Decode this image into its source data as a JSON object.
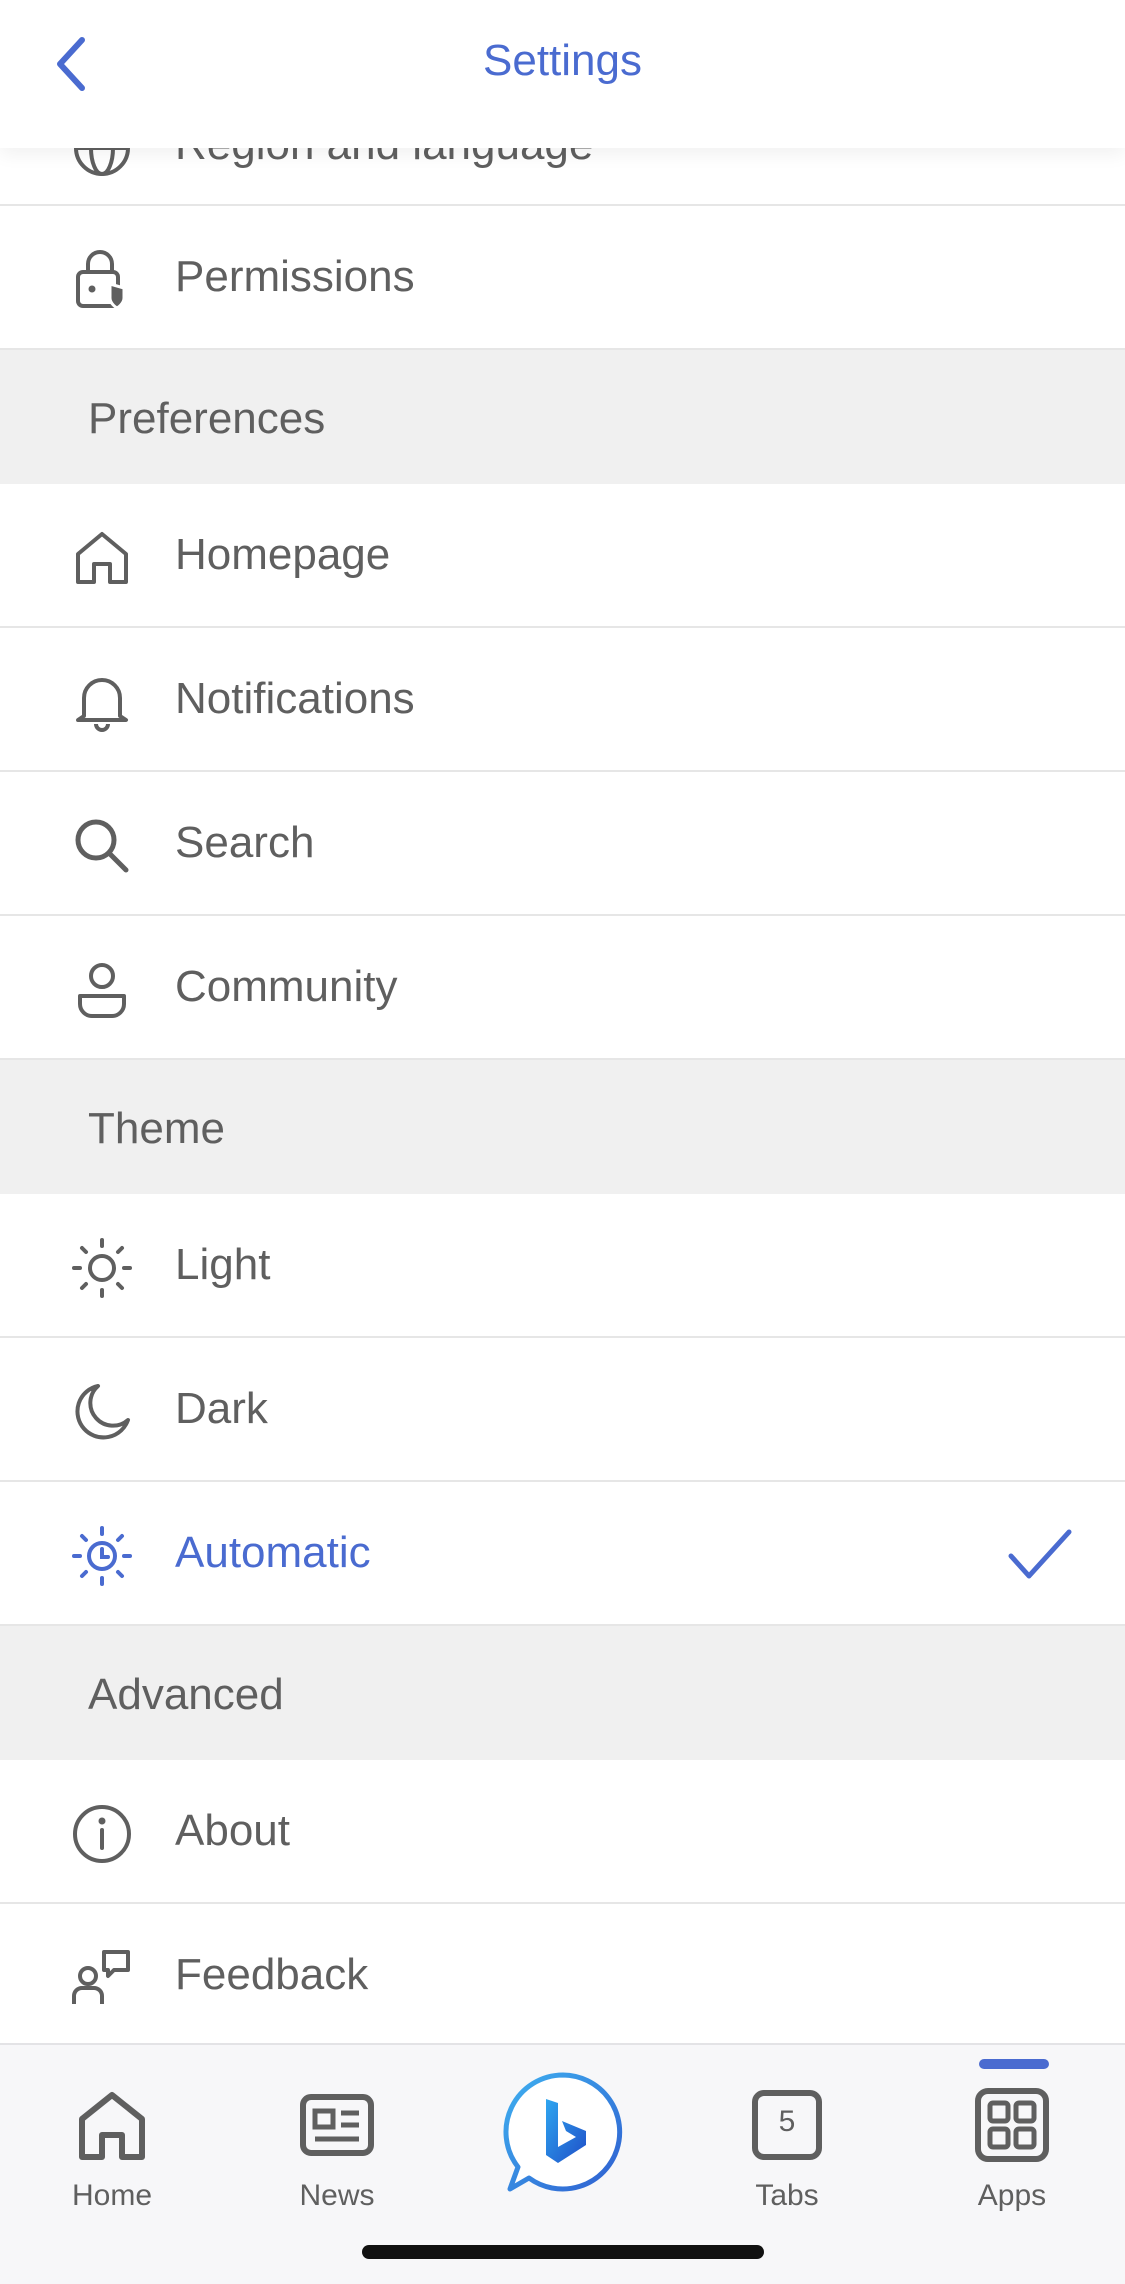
{
  "header": {
    "title": "Settings"
  },
  "partial_row": {
    "label": "Region and language"
  },
  "rows_top": [
    {
      "label": "Permissions",
      "icon": "lock-shield-icon"
    }
  ],
  "sections": {
    "preferences": "Preferences",
    "theme": "Theme",
    "advanced": "Advanced"
  },
  "preferences": [
    {
      "label": "Homepage",
      "icon": "home-icon"
    },
    {
      "label": "Notifications",
      "icon": "bell-icon"
    },
    {
      "label": "Search",
      "icon": "search-icon"
    },
    {
      "label": "Community",
      "icon": "person-icon"
    }
  ],
  "theme": [
    {
      "label": "Light",
      "icon": "sun-icon",
      "selected": false
    },
    {
      "label": "Dark",
      "icon": "moon-icon",
      "selected": false
    },
    {
      "label": "Automatic",
      "icon": "sun-clock-icon",
      "selected": true
    }
  ],
  "advanced": [
    {
      "label": "About",
      "icon": "info-icon"
    },
    {
      "label": "Feedback",
      "icon": "feedback-icon"
    }
  ],
  "bottom_nav": {
    "home": "Home",
    "news": "News",
    "tabs": "Tabs",
    "tabs_count": "5",
    "apps": "Apps",
    "active": "Apps"
  },
  "colors": {
    "accent": "#4a6bd0",
    "text": "#5f5f5f",
    "section_bg": "#f0f0f0"
  }
}
